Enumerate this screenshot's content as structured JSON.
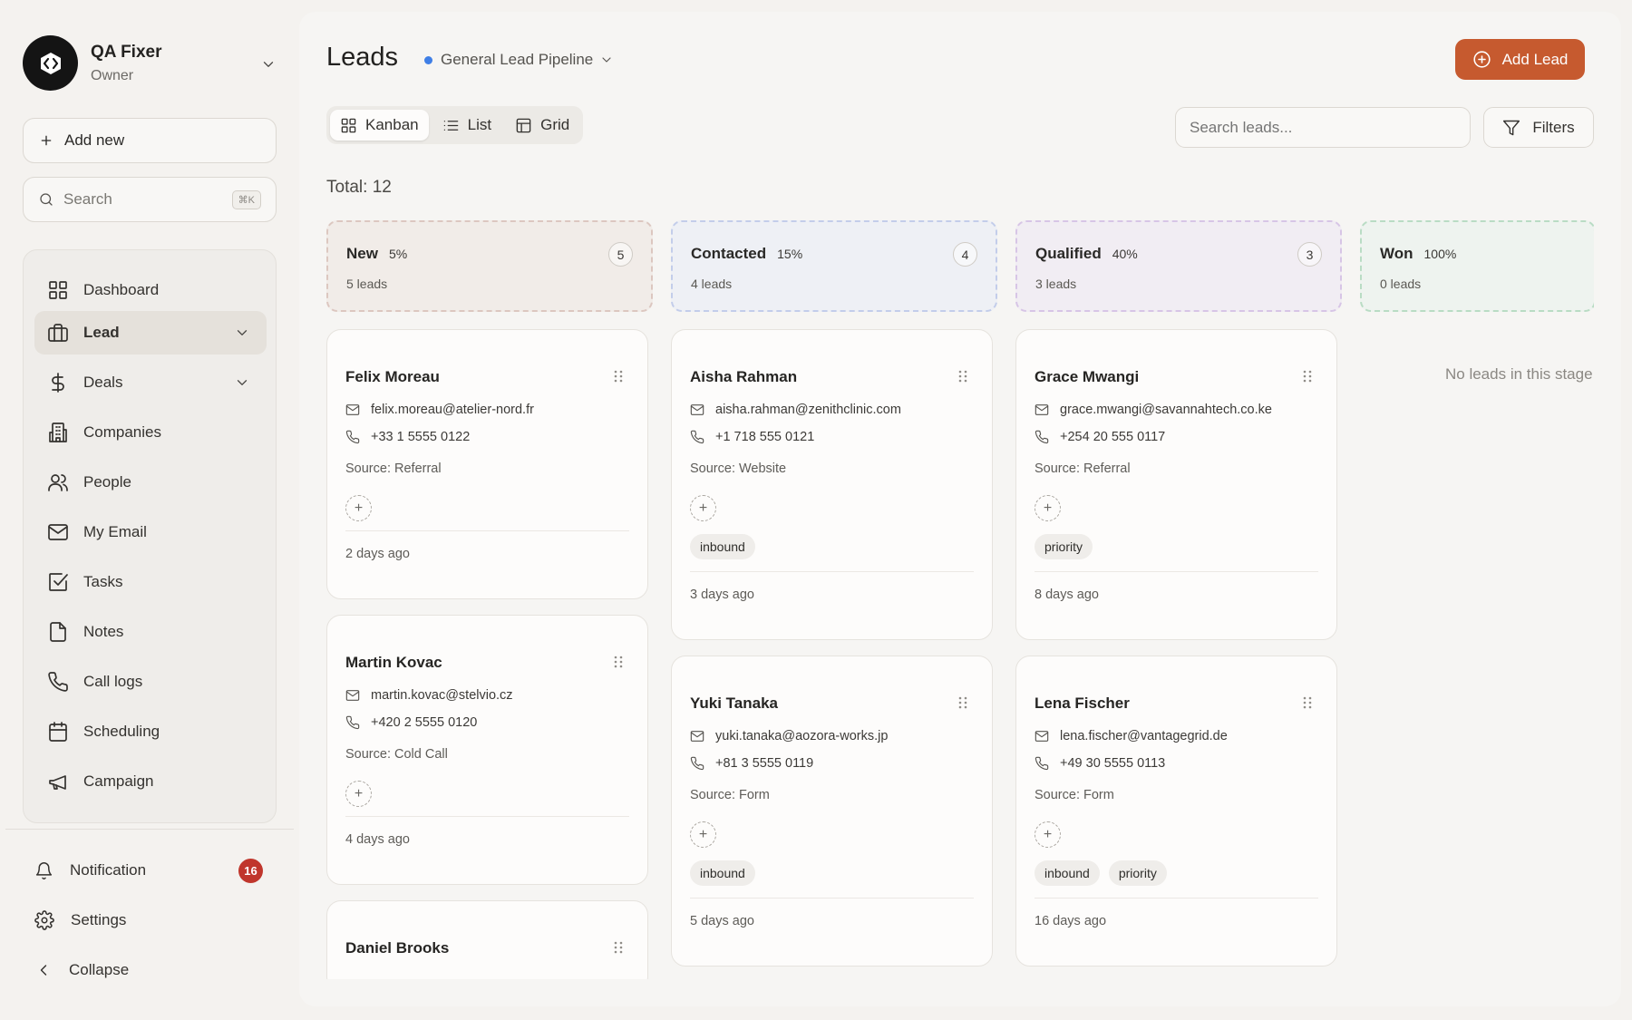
{
  "workspace": {
    "name": "QA Fixer",
    "role": "Owner"
  },
  "sidebar": {
    "add_new": "Add new",
    "search_placeholder": "Search",
    "search_shortcut": "⌘K",
    "items": [
      {
        "label": "Dashboard",
        "icon": "dashboard-icon"
      },
      {
        "label": "Lead",
        "icon": "briefcase-icon",
        "active": true,
        "expandable": true
      },
      {
        "label": "Deals",
        "icon": "dollar-icon",
        "expandable": true
      },
      {
        "label": "Companies",
        "icon": "building-icon"
      },
      {
        "label": "People",
        "icon": "users-icon"
      },
      {
        "label": "My Email",
        "icon": "mail-icon"
      },
      {
        "label": "Tasks",
        "icon": "checkbox-icon"
      },
      {
        "label": "Notes",
        "icon": "note-icon"
      },
      {
        "label": "Call logs",
        "icon": "phone-icon"
      },
      {
        "label": "Scheduling",
        "icon": "calendar-icon"
      },
      {
        "label": "Campaign",
        "icon": "megaphone-icon"
      }
    ],
    "footer": {
      "notification": "Notification",
      "notification_count": "16",
      "settings": "Settings",
      "collapse": "Collapse"
    }
  },
  "header": {
    "title": "Leads",
    "pipeline": "General Lead Pipeline",
    "add_lead": "Add Lead",
    "views": [
      "Kanban",
      "List",
      "Grid"
    ],
    "active_view": "Kanban",
    "search_placeholder": "Search leads...",
    "filters": "Filters",
    "total": "Total: 12"
  },
  "colors": {
    "accent": "#c65a2f",
    "badge": "#c0362c",
    "pipeline_dot": "#3f7fe6"
  },
  "stages": [
    {
      "name": "New",
      "pct": "5%",
      "count": "5",
      "sub": "5 leads",
      "border": "#dcc7c0",
      "bg": "#f1ece8",
      "cards": [
        {
          "name": "Felix Moreau",
          "email": "felix.moreau@atelier-nord.fr",
          "phone": "+33 1 5555 0122",
          "source": "Source: Referral",
          "tags": [],
          "ago": "2 days ago"
        },
        {
          "name": "Martin Kovac",
          "email": "martin.kovac@stelvio.cz",
          "phone": "+420 2 5555 0120",
          "source": "Source: Cold Call",
          "tags": [],
          "ago": "4 days ago"
        },
        {
          "name": "Daniel Brooks",
          "email": "",
          "phone": "",
          "source": "",
          "tags": [],
          "ago": ""
        }
      ]
    },
    {
      "name": "Contacted",
      "pct": "15%",
      "count": "4",
      "sub": "4 leads",
      "border": "#c3cdea",
      "bg": "#eef0f5",
      "cards": [
        {
          "name": "Aisha Rahman",
          "email": "aisha.rahman@zenithclinic.com",
          "phone": "+1 718 555 0121",
          "source": "Source: Website",
          "tags": [
            "inbound"
          ],
          "ago": "3 days ago"
        },
        {
          "name": "Yuki Tanaka",
          "email": "yuki.tanaka@aozora-works.jp",
          "phone": "+81 3 5555 0119",
          "source": "Source: Form",
          "tags": [
            "inbound"
          ],
          "ago": "5 days ago"
        }
      ]
    },
    {
      "name": "Qualified",
      "pct": "40%",
      "count": "3",
      "sub": "3 leads",
      "border": "#d7c5e6",
      "bg": "#f1edf3",
      "cards": [
        {
          "name": "Grace Mwangi",
          "email": "grace.mwangi@savannahtech.co.ke",
          "phone": "+254 20 555 0117",
          "source": "Source: Referral",
          "tags": [
            "priority"
          ],
          "ago": "8 days ago"
        },
        {
          "name": "Lena Fischer",
          "email": "lena.fischer@vantagegrid.de",
          "phone": "+49 30 5555 0113",
          "source": "Source: Form",
          "tags": [
            "inbound",
            "priority"
          ],
          "ago": "16 days ago"
        }
      ]
    },
    {
      "name": "Won",
      "pct": "100%",
      "count": "0",
      "sub": "0 leads",
      "border": "#b9dcc4",
      "bg": "#eef3ef",
      "empty": "No leads in this stage",
      "cards": []
    }
  ]
}
